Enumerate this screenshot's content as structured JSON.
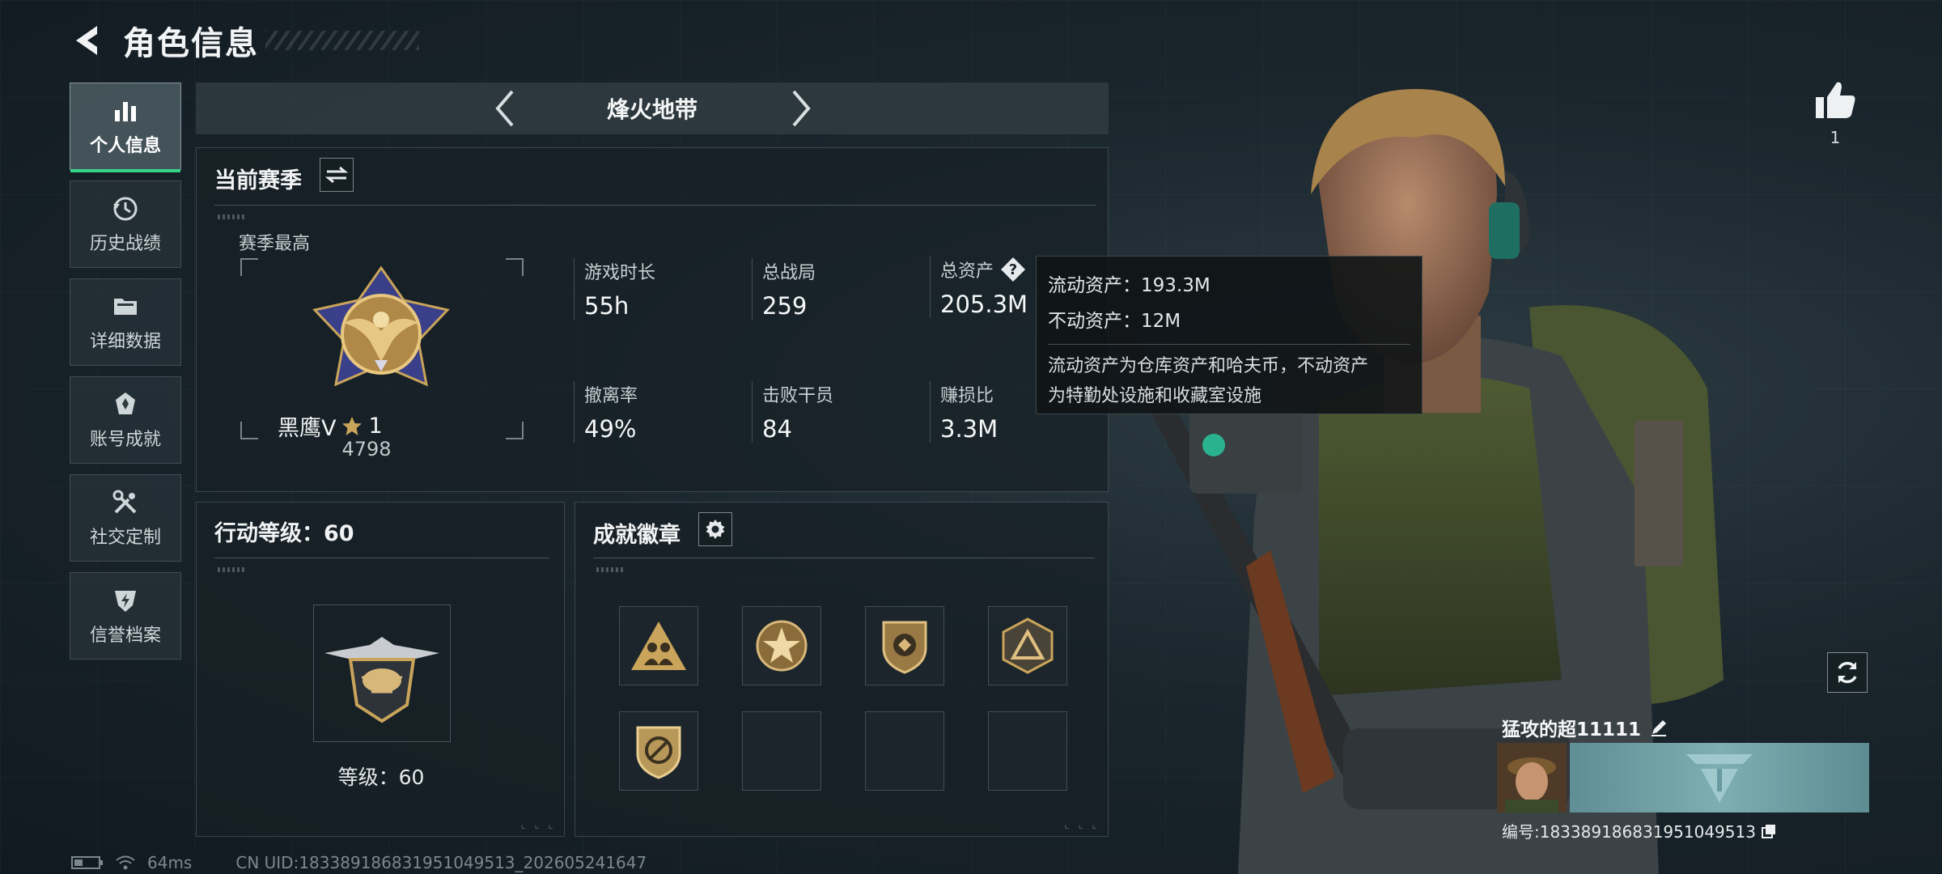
{
  "header": {
    "title": "角色信息"
  },
  "nav": {
    "items": [
      {
        "label": "个人信息",
        "icon": "bar-chart-icon",
        "active": true
      },
      {
        "label": "历史战绩",
        "icon": "history-clock-icon",
        "active": false
      },
      {
        "label": "详细数据",
        "icon": "folder-icon",
        "active": false
      },
      {
        "label": "账号成就",
        "icon": "achievement-icon",
        "active": false
      },
      {
        "label": "社交定制",
        "icon": "tools-icon",
        "active": false
      },
      {
        "label": "信誉档案",
        "icon": "shield-icon",
        "active": false
      }
    ]
  },
  "mode": {
    "title": "烽火地带"
  },
  "season": {
    "title": "当前赛季",
    "best_label": "赛季最高",
    "rank_name": "黑鹰V",
    "rank_stars": "1",
    "rank_score": "4798",
    "stats": {
      "play_time_label": "游戏时长",
      "play_time_value": "55h",
      "total_matches_label": "总战局",
      "total_matches_value": "259",
      "total_assets_label": "总资产",
      "total_assets_value": "205.3M",
      "extract_rate_label": "撤离率",
      "extract_rate_value": "49%",
      "kills_label": "击败干员",
      "kills_value": "84",
      "profit_label": "赚损比",
      "profit_value": "3.3M"
    }
  },
  "tooltip": {
    "liquid": "流动资产：193.3M",
    "fixed": "不动资产：12M",
    "desc_line1": "流动资产为仓库资产和哈夫币，不动资产",
    "desc_line2": "为特勤处设施和收藏室设施"
  },
  "action_level": {
    "title": "行动等级：60",
    "level_text": "等级：60"
  },
  "badges": {
    "title": "成就徽章",
    "slots": [
      "badge-team-icon",
      "badge-star-icon",
      "badge-shield-arrows-icon",
      "badge-triangle-icon",
      "badge-no-weapon-icon",
      "",
      "",
      ""
    ]
  },
  "player": {
    "name": "猛攻的超11111",
    "id_text": "编号:1833891868319510495​13",
    "likes": "1"
  },
  "status": {
    "ping": "64ms",
    "uid": "CN UID:18338918683195104951​3_202605241647"
  },
  "colors": {
    "accent": "#35d489",
    "gold": "#c9a45a",
    "panel_bg": "#162026"
  }
}
